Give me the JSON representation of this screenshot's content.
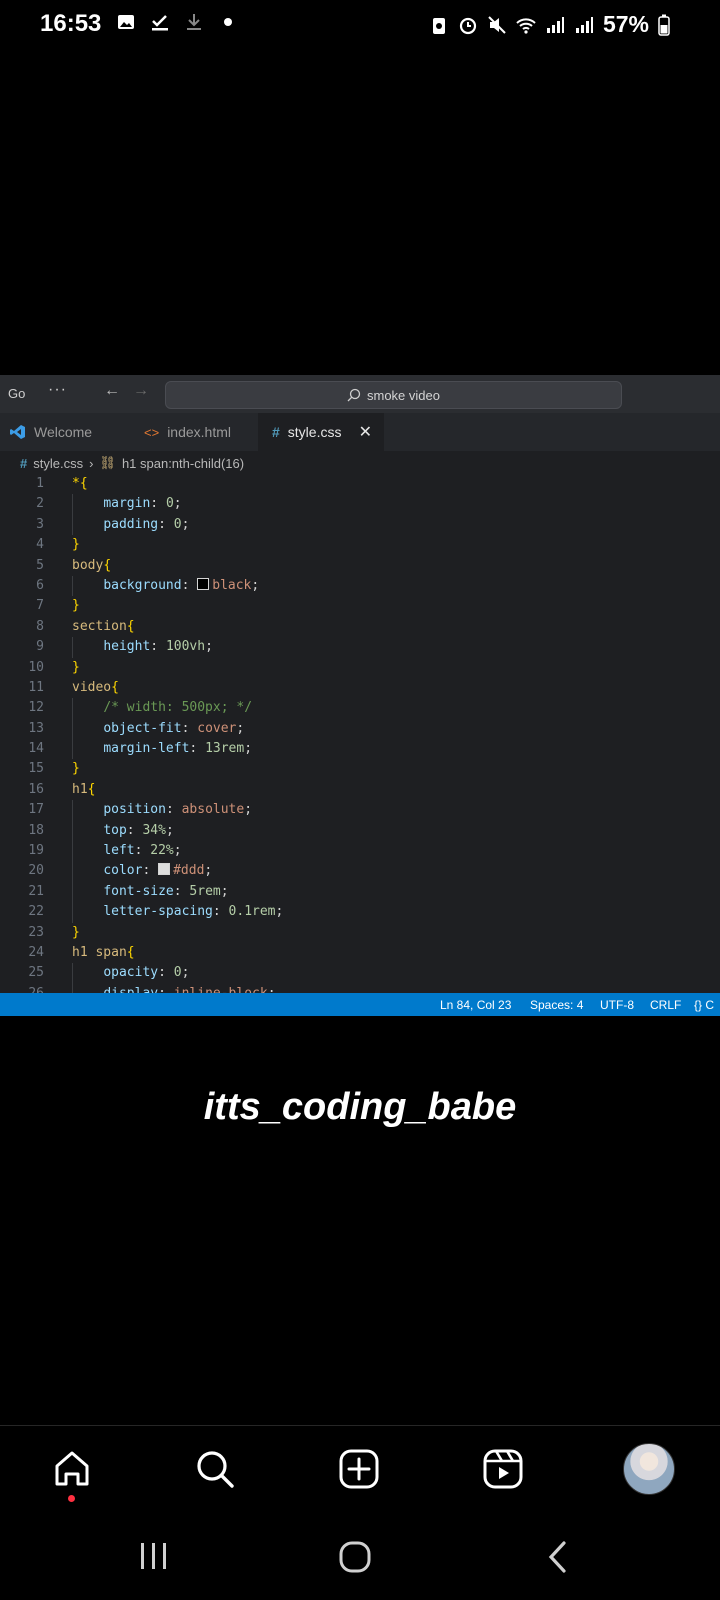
{
  "status_bar": {
    "time": "16:53",
    "battery": "57%",
    "left_icons": [
      "gallery-icon",
      "check-icon",
      "download-icon",
      "dot-icon"
    ],
    "right_icons": [
      "battery-saver-icon",
      "alarm-icon",
      "mute-icon",
      "wifi-icon",
      "signal-icon",
      "signal-icon",
      "battery-icon"
    ]
  },
  "editor": {
    "menu_go": "Go",
    "menu_more": "···",
    "search_text": "smoke video",
    "tabs": [
      {
        "label": "Welcome",
        "icon": "vscode-icon"
      },
      {
        "label": "index.html",
        "icon": "html-icon"
      },
      {
        "label": "style.css",
        "icon": "css-hash-icon",
        "active": true
      }
    ],
    "breadcrumb": {
      "file": "style.css",
      "symbol": "h1 span:nth-child(16)"
    },
    "code_lines": [
      {
        "n": "1"
      },
      {
        "n": "2"
      },
      {
        "n": "3"
      },
      {
        "n": "4"
      },
      {
        "n": "5"
      },
      {
        "n": "6"
      },
      {
        "n": "7"
      },
      {
        "n": "8"
      },
      {
        "n": "9"
      },
      {
        "n": "10"
      },
      {
        "n": "11"
      },
      {
        "n": "12"
      },
      {
        "n": "13"
      },
      {
        "n": "14"
      },
      {
        "n": "15"
      },
      {
        "n": "16"
      },
      {
        "n": "17"
      },
      {
        "n": "18"
      },
      {
        "n": "19"
      },
      {
        "n": "20"
      },
      {
        "n": "21"
      },
      {
        "n": "22"
      },
      {
        "n": "23"
      },
      {
        "n": "24"
      },
      {
        "n": "25"
      },
      {
        "n": "26"
      }
    ],
    "code": {
      "l1": "*{",
      "l2_p": "margin",
      "l2_v": "0",
      "l3_p": "padding",
      "l3_v": "0",
      "l4": "}",
      "l5_s": "body",
      "l5_b": "{",
      "l6_p": "background",
      "l6_v": "black",
      "l7": "}",
      "l8_s": "section",
      "l8_b": "{",
      "l9_p": "height",
      "l9_v": "100vh",
      "l10": "}",
      "l11_s": "video",
      "l11_b": "{",
      "l12": "/* width: 500px; */",
      "l13_p": "object-fit",
      "l13_v": "cover",
      "l14_p": "margin-left",
      "l14_v": "13rem",
      "l15": "}",
      "l16_s": "h1",
      "l16_b": "{",
      "l17_p": "position",
      "l17_v": "absolute",
      "l18_p": "top",
      "l18_v": "34%",
      "l19_p": "left",
      "l19_v": "22%",
      "l20_p": "color",
      "l20_v": "#ddd",
      "l21_p": "font-size",
      "l21_v": "5rem",
      "l22_p": "letter-spacing",
      "l22_v": "0.1rem",
      "l23": "}",
      "l24_s": "h1 span",
      "l24_b": "{",
      "l25_p": "opacity",
      "l25_v": "0",
      "l26_p": "display",
      "l26_v": "inline-block"
    },
    "status": {
      "position": "Ln 84, Col 23",
      "spaces": "Spaces: 4",
      "encoding": "UTF-8",
      "eol": "CRLF",
      "lang": "{} C"
    },
    "colors": {
      "accent": "#007acc",
      "background": "#1e1f22"
    }
  },
  "caption": "itts_coding_babe",
  "bottom_nav": [
    "home-icon",
    "search-icon",
    "create-icon",
    "reels-icon",
    "profile-avatar"
  ],
  "system_nav": [
    "recent-apps-icon",
    "home-circle-icon",
    "back-icon"
  ]
}
